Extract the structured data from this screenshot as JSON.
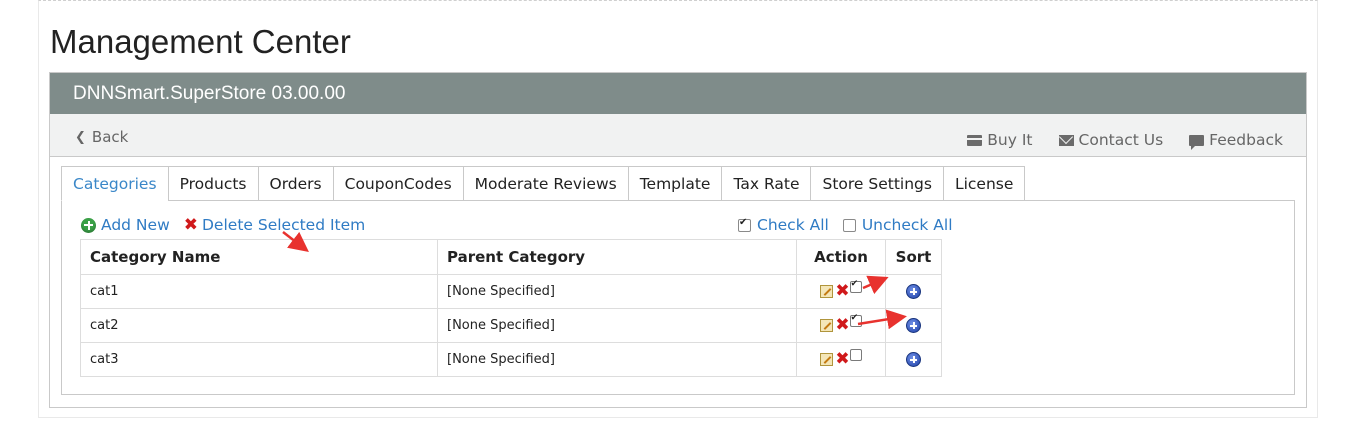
{
  "page": {
    "title": "Management Center"
  },
  "panel": {
    "title": "DNNSmart.SuperStore 03.00.00"
  },
  "toolbar": {
    "back_label": "Back",
    "links": [
      {
        "label": "Buy It",
        "icon": "credit-card-icon"
      },
      {
        "label": "Contact Us",
        "icon": "envelope-icon"
      },
      {
        "label": "Feedback",
        "icon": "comment-icon"
      }
    ]
  },
  "tabs": [
    {
      "label": "Categories",
      "active": true
    },
    {
      "label": "Products"
    },
    {
      "label": "Orders"
    },
    {
      "label": "CouponCodes"
    },
    {
      "label": "Moderate Reviews"
    },
    {
      "label": "Template"
    },
    {
      "label": "Tax Rate"
    },
    {
      "label": "Store Settings"
    },
    {
      "label": "License"
    }
  ],
  "actions": {
    "add_new": "Add New",
    "delete_selected": "Delete Selected Item",
    "check_all": "Check All",
    "uncheck_all": "Uncheck All"
  },
  "table": {
    "headers": [
      "Category Name",
      "Parent Category",
      "Action",
      "Sort"
    ],
    "rows": [
      {
        "name": "cat1",
        "parent": "[None Specified]",
        "checked": true
      },
      {
        "name": "cat2",
        "parent": "[None Specified]",
        "checked": true
      },
      {
        "name": "cat3",
        "parent": "[None Specified]",
        "checked": false
      }
    ]
  },
  "colors": {
    "header_bg": "#7f8c8a",
    "link": "#2f7bc4",
    "delete": "#d0191b",
    "annotation_arrow": "#e8322e"
  }
}
